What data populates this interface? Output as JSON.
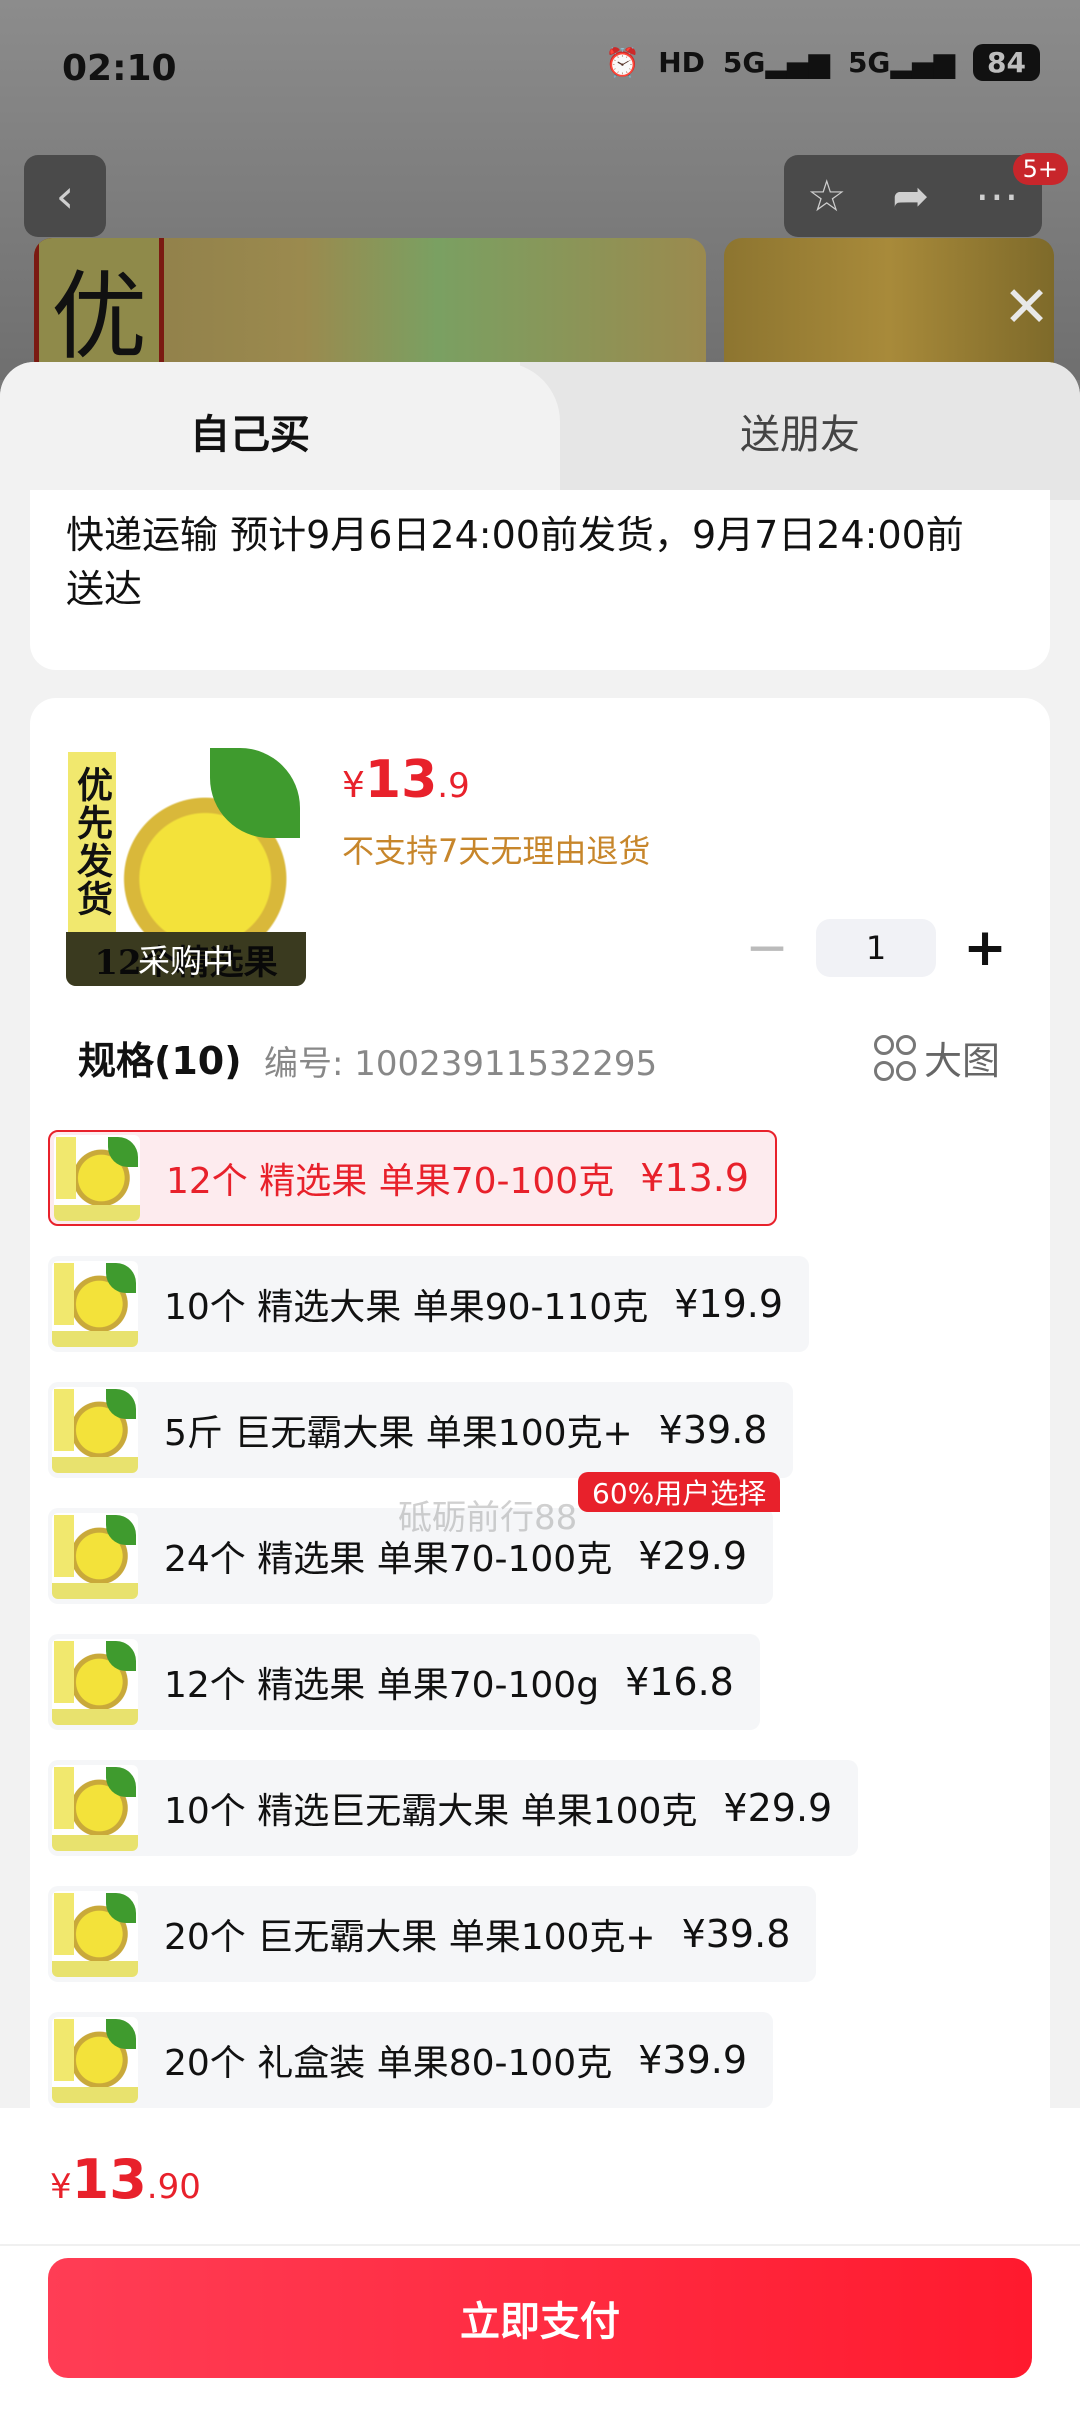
{
  "status_bar": {
    "time": "02:10",
    "icons": [
      "alarm-icon",
      "hd-icon",
      "signal-5g-icon",
      "signal-5g-icon"
    ],
    "battery": "84"
  },
  "nav": {
    "back_icon": "chevron-left-icon",
    "actions": [
      "star-icon",
      "share-icon",
      "more-icon"
    ],
    "badge": "5+",
    "close_icon": "close-icon"
  },
  "hero": {
    "tag": "优"
  },
  "tabs": [
    {
      "label": "自己买",
      "active": true
    },
    {
      "label": "送朋友",
      "active": false
    }
  ],
  "shipping": {
    "text": "快递运输 预计9月6日24:00前发货，9月7日24:00前送达"
  },
  "product": {
    "thumb_tag": "优先发货",
    "thumb_banner": "12个精选果",
    "thumb_overlay": "采购中",
    "price_currency": "¥",
    "price_int": "13",
    "price_dec": ".9",
    "no_return": "不支持7天无理由退货",
    "quantity": "1",
    "minus": "−",
    "plus": "+"
  },
  "specs": {
    "title": "规格(10)",
    "code": "编号: 10023911532295",
    "big_image_label": "大图",
    "badge": "60%用户选择",
    "watermark": "砥砺前行88",
    "options": [
      {
        "label": "12个 精选果 单果70-100克",
        "price": "¥13.9",
        "selected": true
      },
      {
        "label": "10个 精选大果 单果90-110克",
        "price": "¥19.9",
        "selected": false
      },
      {
        "label": "5斤 巨无霸大果 单果100克+",
        "price": "¥39.8",
        "selected": false
      },
      {
        "label": "24个 精选果 单果70-100克",
        "price": "¥29.9",
        "selected": false
      },
      {
        "label": "12个 精选果 单果70-100g",
        "price": "¥16.8",
        "selected": false
      },
      {
        "label": "10个 精选巨无霸大果 单果100克",
        "price": "¥29.9",
        "selected": false
      },
      {
        "label": "20个 巨无霸大果 单果100克+",
        "price": "¥39.8",
        "selected": false
      },
      {
        "label": "20个 礼盒装 单果80-100克",
        "price": "¥39.9",
        "selected": false
      }
    ]
  },
  "footer": {
    "currency": "¥",
    "total_int": "13",
    "total_dec": ".90",
    "pay_label": "立即支付"
  },
  "colors": {
    "accent": "#e8212b",
    "warning": "#c7862b",
    "pay_start": "#ff3d55",
    "pay_end": "#ff1a2e"
  }
}
